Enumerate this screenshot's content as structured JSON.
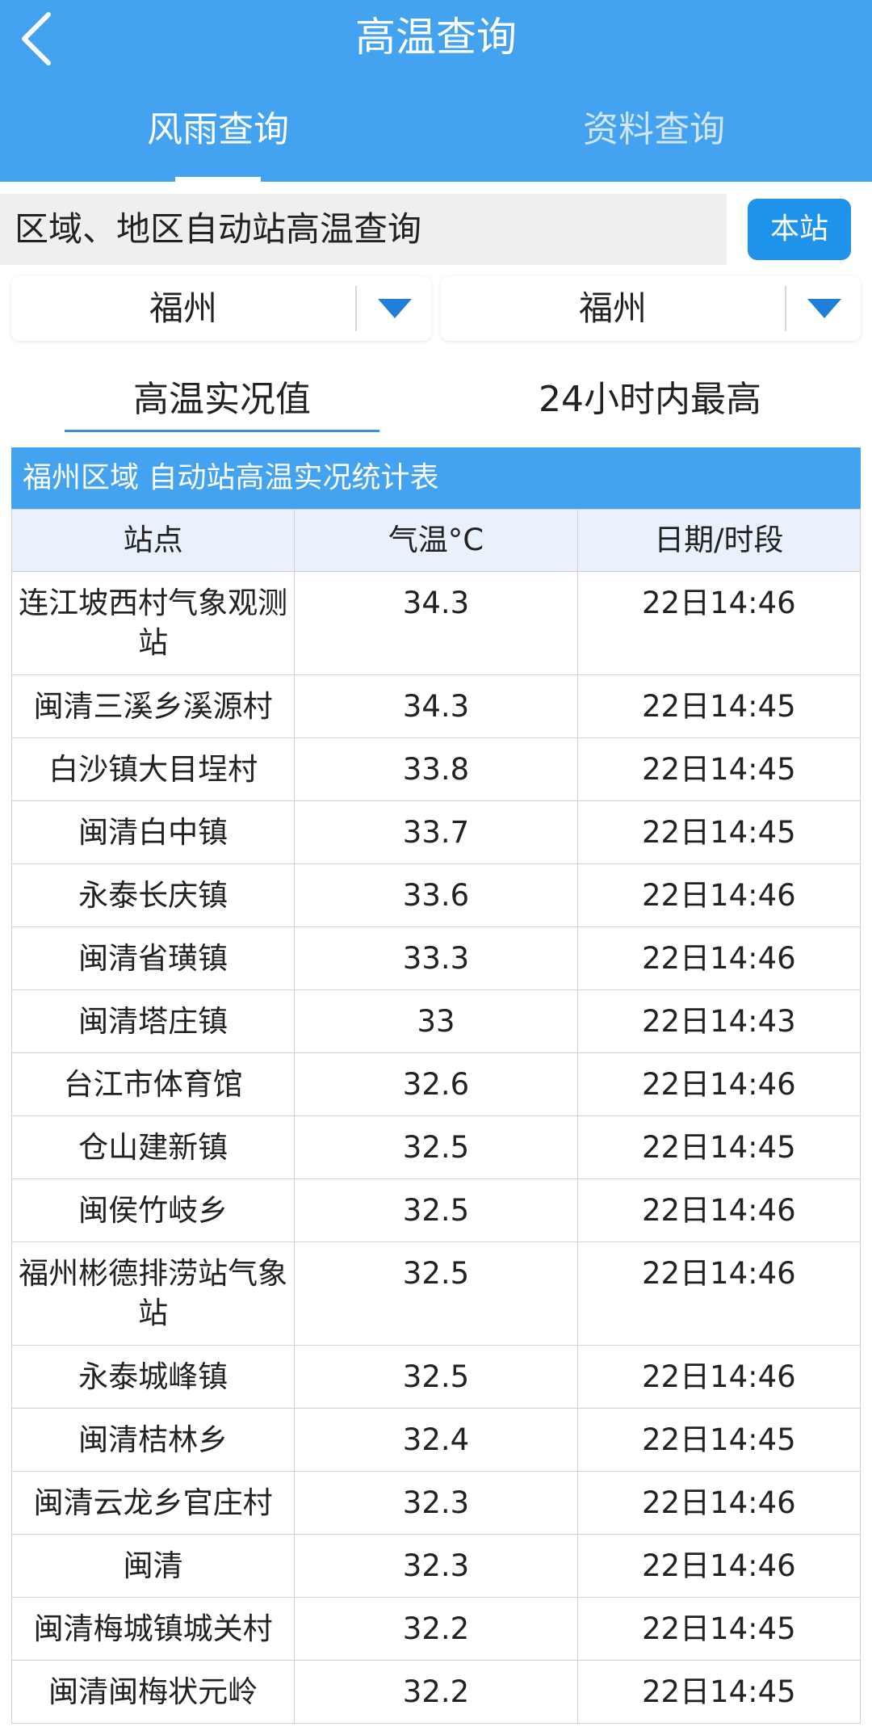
{
  "header": {
    "title": "高温查询",
    "tabs": [
      {
        "label": "风雨查询",
        "active": true
      },
      {
        "label": "资料查询",
        "active": false
      }
    ]
  },
  "query": {
    "label": "区域、地区自动站高温查询",
    "station_button": "本站"
  },
  "selects": [
    {
      "value": "福州"
    },
    {
      "value": "福州"
    }
  ],
  "modes": [
    {
      "label": "高温实况值",
      "active": true
    },
    {
      "label": "24小时内最高",
      "active": false
    }
  ],
  "table": {
    "caption": "福州区域 自动站高温实况统计表",
    "columns": [
      "站点",
      "气温°C",
      "日期/时段"
    ],
    "rows": [
      {
        "station": "连江坡西村气象观测站",
        "temp": "34.3",
        "time": "22日14:46"
      },
      {
        "station": "闽清三溪乡溪源村",
        "temp": "34.3",
        "time": "22日14:45"
      },
      {
        "station": "白沙镇大目埕村",
        "temp": "33.8",
        "time": "22日14:45"
      },
      {
        "station": "闽清白中镇",
        "temp": "33.7",
        "time": "22日14:45"
      },
      {
        "station": "永泰长庆镇",
        "temp": "33.6",
        "time": "22日14:46"
      },
      {
        "station": "闽清省璜镇",
        "temp": "33.3",
        "time": "22日14:46"
      },
      {
        "station": "闽清塔庄镇",
        "temp": "33",
        "time": "22日14:43"
      },
      {
        "station": "台江市体育馆",
        "temp": "32.6",
        "time": "22日14:46"
      },
      {
        "station": "仓山建新镇",
        "temp": "32.5",
        "time": "22日14:45"
      },
      {
        "station": "闽侯竹岐乡",
        "temp": "32.5",
        "time": "22日14:46"
      },
      {
        "station": "福州彬德排涝站气象站",
        "temp": "32.5",
        "time": "22日14:46"
      },
      {
        "station": "永泰城峰镇",
        "temp": "32.5",
        "time": "22日14:46"
      },
      {
        "station": "闽清桔林乡",
        "temp": "32.4",
        "time": "22日14:45"
      },
      {
        "station": "闽清云龙乡官庄村",
        "temp": "32.3",
        "time": "22日14:46"
      },
      {
        "station": "闽清",
        "temp": "32.3",
        "time": "22日14:46"
      },
      {
        "station": "闽清梅城镇城关村",
        "temp": "32.2",
        "time": "22日14:45"
      },
      {
        "station": "闽清闽梅状元岭",
        "temp": "32.2",
        "time": "22日14:45"
      }
    ]
  },
  "colors": {
    "header_bg": "#44a3f0",
    "button_bg": "#1f92ea",
    "table_header_bg": "#e9f2fc"
  },
  "icons": {
    "back": "chevron-left-icon",
    "dropdown": "triangle-down-icon"
  }
}
